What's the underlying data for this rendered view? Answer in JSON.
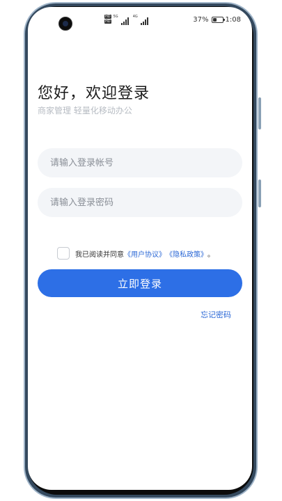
{
  "status_bar": {
    "hd_top": "HD",
    "hd_bottom": "HD",
    "signal_1_label": "5G",
    "signal_2_label": "4G",
    "battery_percent": "37%",
    "time": "1:08"
  },
  "login": {
    "title": "您好，欢迎登录",
    "subtitle": "商家管理 轻量化移动办公",
    "account_placeholder": "请输入登录帐号",
    "password_placeholder": "请输入登录密码",
    "agree_prefix": "我已阅读并同意",
    "user_agreement": "《用户协议》",
    "privacy_policy": "《隐私政策》",
    "agree_suffix": "。",
    "login_button": "立即登录",
    "forgot_password": "忘记密码"
  },
  "colors": {
    "accent": "#2d6fe6",
    "link": "#2c69d6",
    "input_bg": "#f3f5f8"
  }
}
